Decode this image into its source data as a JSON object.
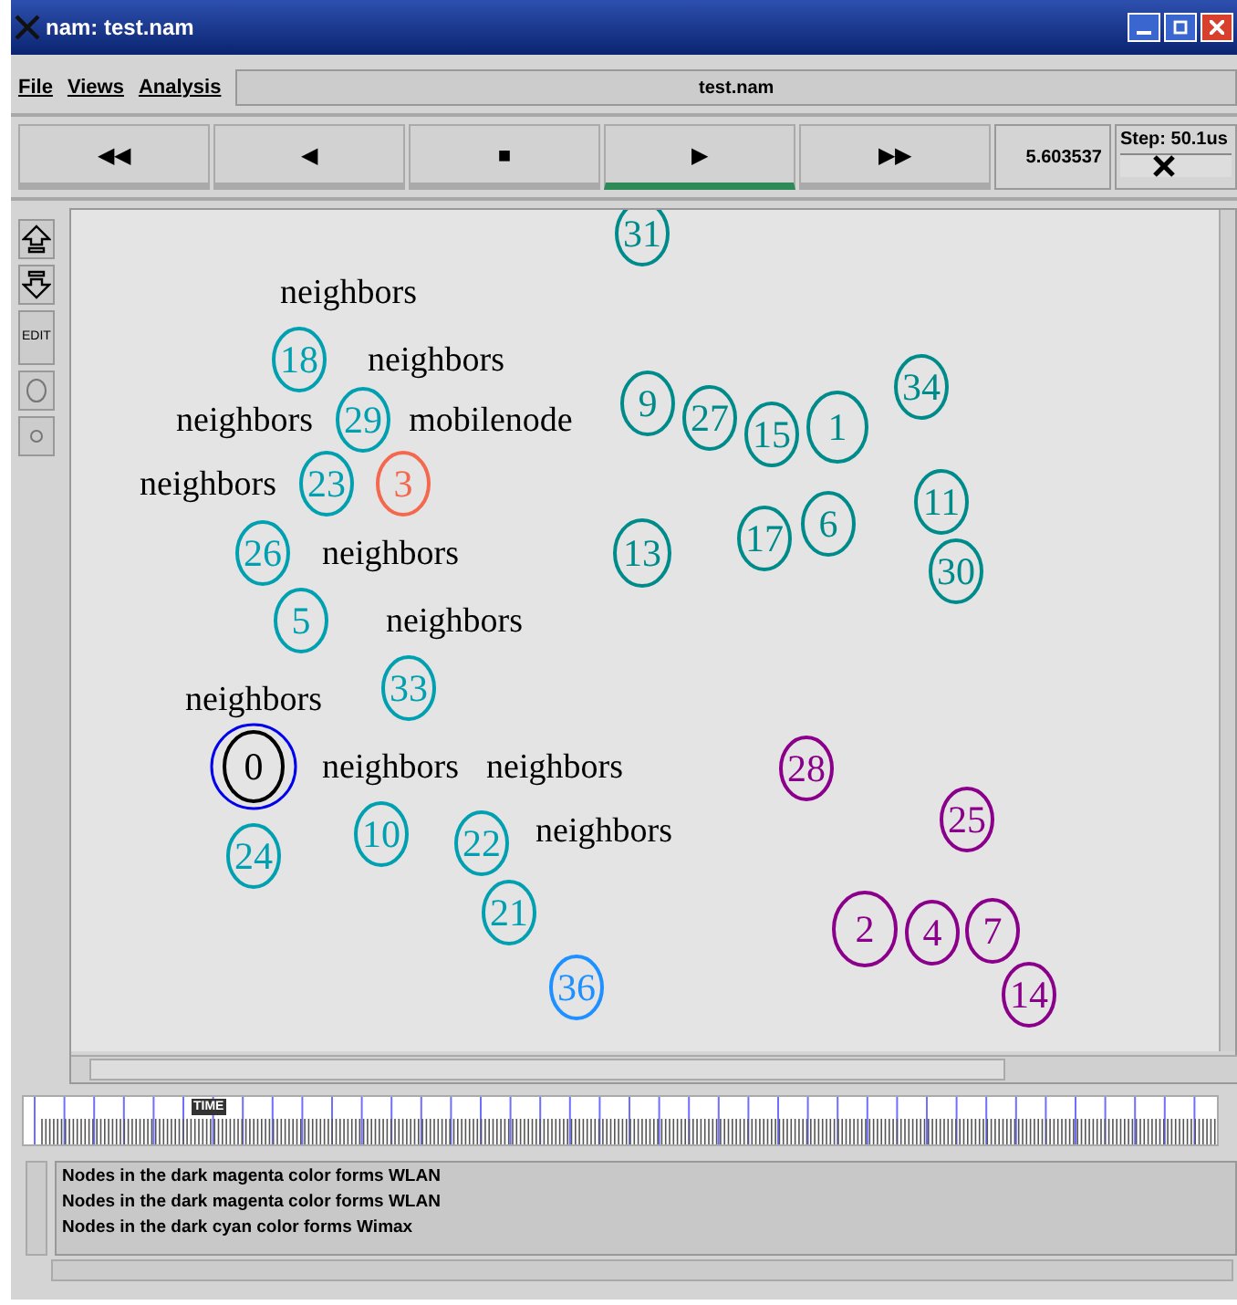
{
  "window": {
    "title": "nam: test.nam"
  },
  "menu": [
    {
      "label": "File"
    },
    {
      "label": "Views"
    },
    {
      "label": "Analysis"
    }
  ],
  "file_name": "test.nam",
  "transport": [
    {
      "label": "◀◀",
      "selected": false
    },
    {
      "label": "◀",
      "selected": false
    },
    {
      "label": "■",
      "selected": false
    },
    {
      "label": "▶",
      "selected": true
    },
    {
      "label": "▶▶",
      "selected": false
    }
  ],
  "time": "5.603537",
  "step": {
    "label": "Step: 50.1us",
    "level": 0.4
  },
  "tools": [
    {
      "kind": "zoom-in"
    },
    {
      "kind": "zoom-out"
    },
    {
      "kind": "text",
      "label": "EDIT"
    },
    {
      "kind": "circle"
    },
    {
      "kind": "dot"
    }
  ],
  "nodes": [
    {
      "label": "31",
      "color": "#008b8b"
    },
    {
      "label": "18",
      "color": "#00a0b0"
    },
    {
      "label": "29",
      "color": "#00a0b0"
    },
    {
      "label": "9",
      "color": "#008b8b"
    },
    {
      "label": "27",
      "color": "#008b8b"
    },
    {
      "label": "15",
      "color": "#008b8b"
    },
    {
      "label": "1",
      "color": "#008b8b"
    },
    {
      "label": "34",
      "color": "#008b8b"
    },
    {
      "label": "23",
      "color": "#00a0b0"
    },
    {
      "label": "26",
      "color": "#00a0b0"
    },
    {
      "label": "3",
      "color": "#f4684e"
    },
    {
      "label": "6",
      "color": "#008b8b"
    },
    {
      "label": "17",
      "color": "#008b8b"
    },
    {
      "label": "11",
      "color": "#008b8b"
    },
    {
      "label": "13",
      "color": "#008b8b"
    },
    {
      "label": "30",
      "color": "#008b8b"
    },
    {
      "label": "5",
      "color": "#00a0b0"
    },
    {
      "label": "33",
      "color": "#00a0b0"
    },
    {
      "label": "0",
      "color": "#000000"
    },
    {
      "label": "28",
      "color": "#8b008b"
    },
    {
      "label": "24",
      "color": "#00a0b0"
    },
    {
      "label": "10",
      "color": "#00a0b0"
    },
    {
      "label": "22",
      "color": "#00a0b0"
    },
    {
      "label": "25",
      "color": "#8b008b"
    },
    {
      "label": "21",
      "color": "#00a0b0"
    },
    {
      "label": "2",
      "color": "#8b008b"
    },
    {
      "label": "4",
      "color": "#8b008b"
    },
    {
      "label": "7",
      "color": "#8b008b"
    },
    {
      "label": "14",
      "color": "#8b008b"
    },
    {
      "label": "36",
      "color": "#1e90ff"
    }
  ],
  "node_labels": [
    {
      "text": "neighbors"
    },
    {
      "text": "neighbors"
    },
    {
      "text": "neighbors"
    },
    {
      "text": "mobilenode"
    },
    {
      "text": "neighbors"
    },
    {
      "text": "neighbors"
    },
    {
      "text": "neighbors"
    },
    {
      "text": "neighbors"
    },
    {
      "text": "neighbors"
    },
    {
      "text": "neighbors"
    },
    {
      "text": "neighbors"
    }
  ],
  "timeline": {
    "marker": "TIME"
  },
  "log": [
    "Nodes in the dark magenta color forms WLAN",
    "Nodes in the dark magenta color forms WLAN",
    "Nodes in the dark cyan color forms Wimax"
  ]
}
